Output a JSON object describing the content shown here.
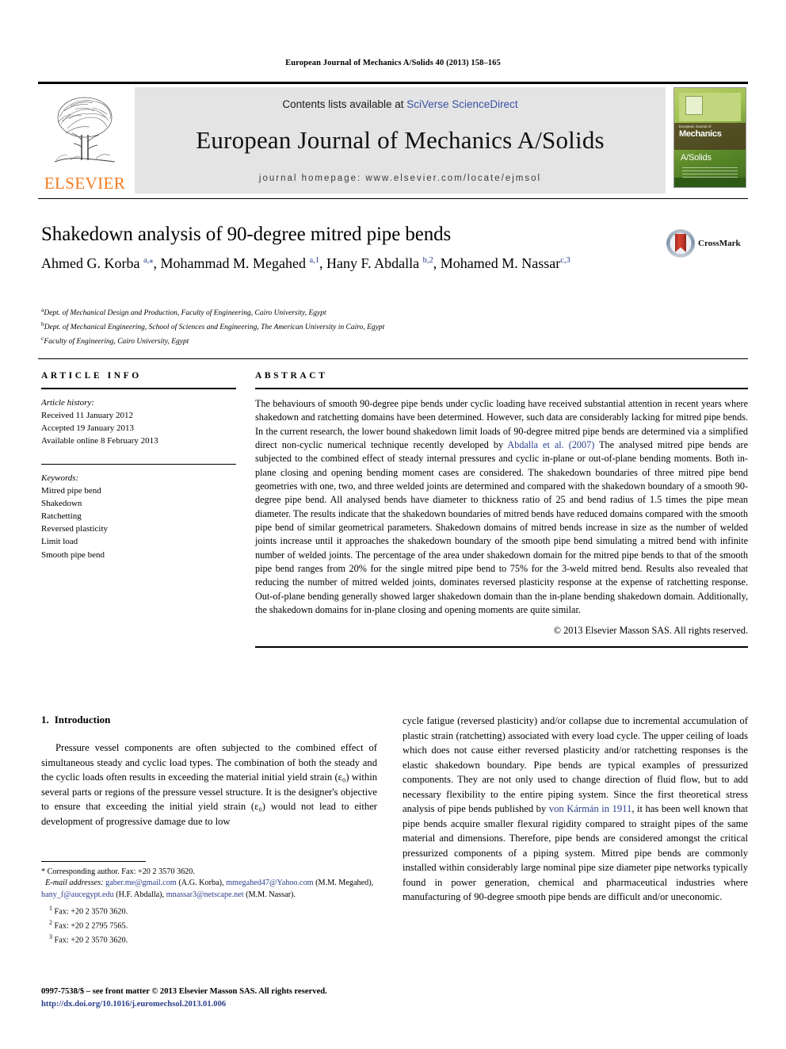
{
  "running_head": "European Journal of Mechanics A/Solids 40 (2013) 158–165",
  "masthead": {
    "publisher_name": "ELSEVIER",
    "contents_prefix": "Contents lists available at ",
    "contents_link": "SciVerse ScienceDirect",
    "journal_title": "European Journal of Mechanics A/Solids",
    "homepage": "journal homepage: www.elsevier.com/locate/ejmsol",
    "cover": {
      "line1": "European Journal of",
      "line2": "Mechanics",
      "line3": "A/Solids"
    }
  },
  "article": {
    "title": "Shakedown analysis of 90-degree mitred pipe bends",
    "authors_html": "Ahmed G. Korba <sup>a,⁎</sup>, Mohammad M. Megahed <sup>a,1</sup>, Hany F. Abdalla <sup>b,2</sup>, Mohamed M. Nassar<sup>c,3</sup>",
    "affiliations": [
      {
        "mark": "a",
        "text": "Dept. of Mechanical Design and Production, Faculty of Engineering, Cairo University, Egypt"
      },
      {
        "mark": "b",
        "text": "Dept. of Mechanical Engineering, School of Sciences and Engineering, The American University in Cairo, Egypt"
      },
      {
        "mark": "c",
        "text": "Faculty of Engineering, Cairo University, Egypt"
      }
    ],
    "crossmark_label": "CrossMark"
  },
  "article_info": {
    "heading": "ARTICLE INFO",
    "history_label": "Article history:",
    "history": [
      "Received 11 January 2012",
      "Accepted 19 January 2013",
      "Available online 8 February 2013"
    ],
    "keywords_label": "Keywords:",
    "keywords": [
      "Mitred pipe bend",
      "Shakedown",
      "Ratchetting",
      "Reversed plasticity",
      "Limit load",
      "Smooth pipe bend"
    ]
  },
  "abstract": {
    "heading": "ABSTRACT",
    "part1": "The behaviours of smooth 90-degree pipe bends under cyclic loading have received substantial attention in recent years where shakedown and ratchetting domains have been determined. However, such data are considerably lacking for mitred pipe bends. In the current research, the lower bound shakedown limit loads of 90-degree mitred pipe bends are determined via a simplified direct non-cyclic numerical technique recently developed by ",
    "ref_link": "Abdalla et al. (2007)",
    "part2": " The analysed mitred pipe bends are subjected to the combined effect of steady internal pressures and cyclic in-plane or out-of-plane bending moments. Both in-plane closing and opening bending moment cases are considered. The shakedown boundaries of three mitred pipe bend geometries with one, two, and three welded joints are determined and compared with the shakedown boundary of a smooth 90-degree pipe bend. All analysed bends have diameter to thickness ratio of 25 and bend radius of 1.5 times the pipe mean diameter. The results indicate that the shakedown boundaries of mitred bends have reduced domains compared with the smooth pipe bend of similar geometrical parameters. Shakedown domains of mitred bends increase in size as the number of welded joints increase until it approaches the shakedown boundary of the smooth pipe bend simulating a mitred bend with infinite number of welded joints. The percentage of the area under shakedown domain for the mitred pipe bends to that of the smooth pipe bend ranges from 20% for the single mitred pipe bend to 75% for the 3-weld mitred bend. Results also revealed that reducing the number of mitred welded joints, dominates reversed plasticity response at the expense of ratchetting response. Out-of-plane bending generally showed larger shakedown domain than the in-plane bending shakedown domain. Additionally, the shakedown domains for in-plane closing and opening moments are quite similar.",
    "copyright": "© 2013 Elsevier Masson SAS. All rights reserved."
  },
  "body": {
    "section_number": "1.",
    "section_title": "Introduction",
    "left_para": "Pressure vessel components are often subjected to the combined effect of simultaneous steady and cyclic load types. The combination of both the steady and the cyclic loads often results in exceeding the material initial yield strain (ε₀) within several parts or regions of the pressure vessel structure. It is the designer's objective to ensure that exceeding the initial yield strain (ε₀) would not lead to either development of progressive damage due to low",
    "right_para_1": "cycle fatigue (reversed plasticity) and/or collapse due to incremental accumulation of plastic strain (ratchetting) associated with every load cycle. The upper ceiling of loads which does not cause either reversed plasticity and/or ratchetting responses is the elastic shakedown boundary. Pipe bends are typical examples of pressurized components. They are not only used to change direction of fluid flow, but to add necessary flexibility to the entire piping system. Since the first theoretical stress analysis of pipe bends published by ",
    "right_ref_link": "von Kármán in 1911",
    "right_para_2": ", it has been well known that pipe bends acquire smaller flexural rigidity compared to straight pipes of the same material and dimensions. Therefore, pipe bends are considered amongst the critical pressurized components of a piping system. Mitred pipe bends are commonly installed within considerably large nominal pipe size diameter pipe networks typically found in power generation, chemical and pharmaceutical industries where manufacturing of 90-degree smooth pipe bends are difficult and/or uneconomic."
  },
  "footnotes": {
    "corresponding": "* Corresponding author. Fax: +20 2 3570 3620.",
    "email_label": "E-mail addresses:",
    "emails": [
      {
        "address": "gaber.me@gmail.com",
        "owner": "(A.G. Korba)"
      },
      {
        "address": "mmegahed47@Yahoo.com",
        "owner": "(M.M. Megahed)"
      },
      {
        "address": "hany_f@aucegypt.edu",
        "owner": "(H.F. Abdalla)"
      },
      {
        "address": "mnassar3@netscape.net",
        "owner": "(M.M. Nassar)."
      }
    ],
    "numbered": [
      {
        "num": "1",
        "text": "Fax: +20 2 3570 3620."
      },
      {
        "num": "2",
        "text": "Fax: +20 2 2795 7565."
      },
      {
        "num": "3",
        "text": "Fax: +20 2 3570 3620."
      }
    ]
  },
  "imprint": {
    "line1": "0997-7538/$ – see front matter © 2013 Elsevier Masson SAS. All rights reserved.",
    "doi": "http://dx.doi.org/10.1016/j.euromechsol.2013.01.006"
  },
  "colors": {
    "elsevier_orange": "#F47B20",
    "link_blue": "#2b3f8c",
    "band_grey": "#e4e4e4",
    "crossmark_red": "#c7352b"
  }
}
